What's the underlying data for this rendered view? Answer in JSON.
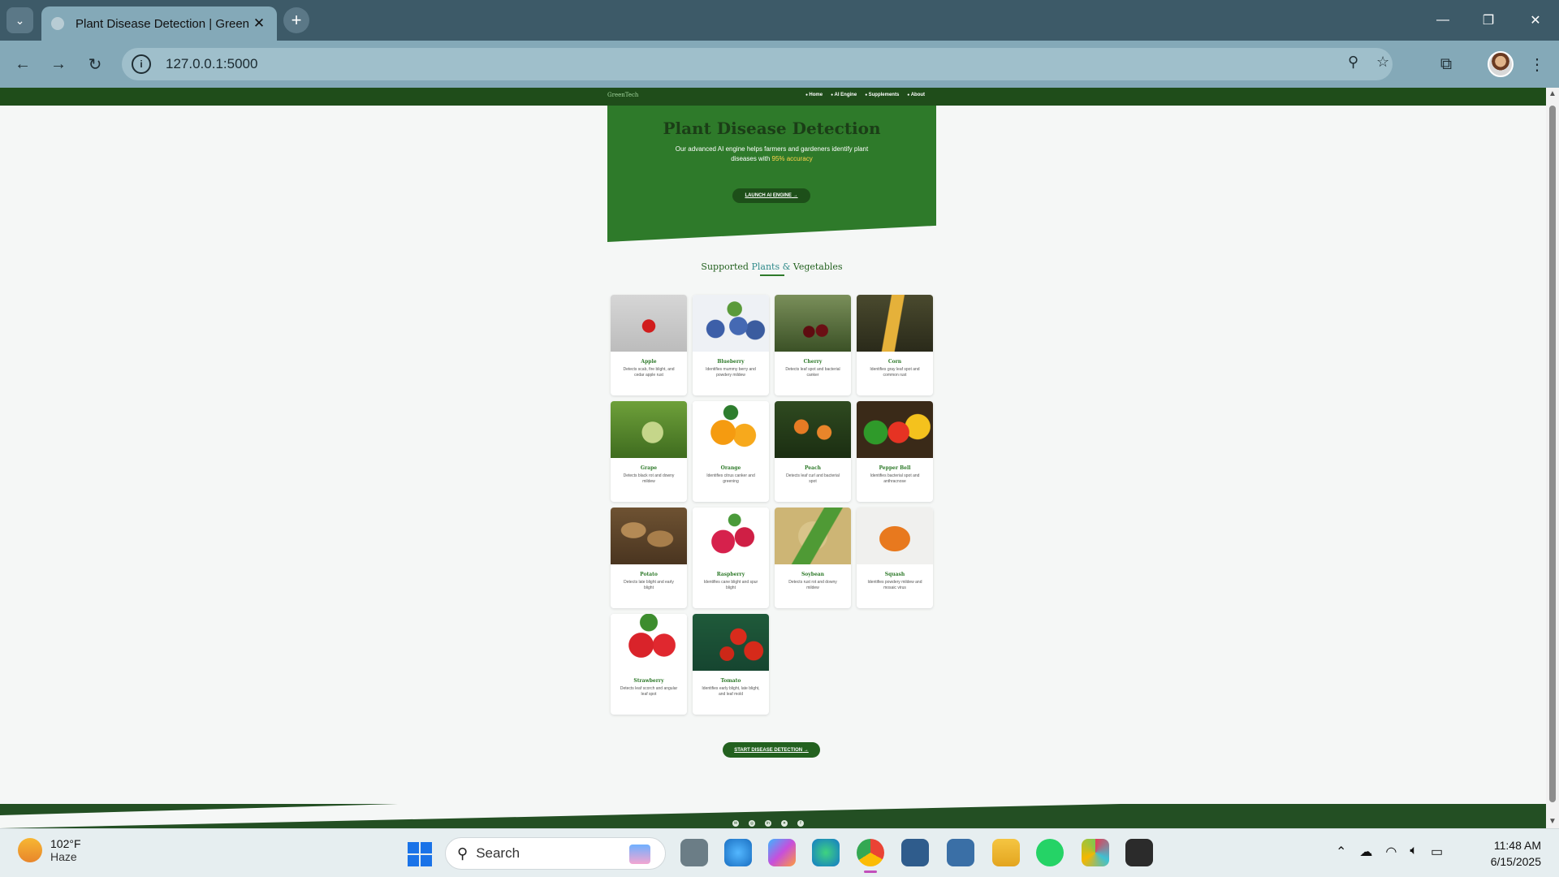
{
  "browser": {
    "tab_title": "Plant Disease Detection | Green",
    "url": "127.0.0.1:5000"
  },
  "site": {
    "logo": "GreenTech",
    "nav": [
      {
        "label": "Home",
        "icon": "home-icon",
        "active": true
      },
      {
        "label": "AI Engine",
        "icon": "robot-icon",
        "active": false
      },
      {
        "label": "Supplements",
        "icon": "store-icon",
        "active": false
      },
      {
        "label": "About",
        "icon": "user-icon",
        "active": false
      }
    ],
    "hero": {
      "title": "Plant Disease Detection",
      "subtitle_part1": "Our advanced AI engine helps farmers and gardeners identify plant diseases with ",
      "subtitle_accent": "95% accuracy",
      "button": "LAUNCH AI ENGINE"
    },
    "section_title_a": "Supported ",
    "section_title_b": "Plants & ",
    "section_title_c": "Vegetables",
    "plants": [
      {
        "name": "Apple",
        "desc": "Detects scab, fire blight, and cedar apple rust",
        "img": "apple"
      },
      {
        "name": "Blueberry",
        "desc": "Identifies mummy berry and powdery mildew",
        "img": "blueberry"
      },
      {
        "name": "Cherry",
        "desc": "Detects leaf spot and bacterial canker",
        "img": "cherry"
      },
      {
        "name": "Corn",
        "desc": "Identifies gray leaf spot and common rust",
        "img": "corn"
      },
      {
        "name": "Grape",
        "desc": "Detects black rot and downy mildew",
        "img": "grape"
      },
      {
        "name": "Orange",
        "desc": "Identifies citrus canker and greening",
        "img": "orange"
      },
      {
        "name": "Peach",
        "desc": "Detects leaf curl and bacterial spot",
        "img": "peach"
      },
      {
        "name": "Pepper Bell",
        "desc": "Identifies bacterial spot and anthracnose",
        "img": "pepper"
      },
      {
        "name": "Potato",
        "desc": "Detects late blight and early blight",
        "img": "potato"
      },
      {
        "name": "Raspberry",
        "desc": "Identifies cane blight and spur blight",
        "img": "raspberry"
      },
      {
        "name": "Soybean",
        "desc": "Detects rust rot and downy mildew",
        "img": "soybean"
      },
      {
        "name": "Squash",
        "desc": "Identifies powdery mildew and mosaic virus",
        "img": "squash"
      },
      {
        "name": "Strawberry",
        "desc": "Detects leaf scorch and angular leaf spot",
        "img": "strawberry"
      },
      {
        "name": "Tomato",
        "desc": "Identifies early blight, late blight, and leaf mold",
        "img": "tomato"
      }
    ],
    "cta": "START DISEASE DETECTION",
    "footer_icons": [
      "email-icon",
      "instagram-icon",
      "linkedin-icon",
      "twitter-icon",
      "facebook-icon"
    ]
  },
  "taskbar": {
    "weather_temp": "102°F",
    "weather_cond": "Haze",
    "search_label": "Search",
    "time": "11:48 AM",
    "date": "6/15/2025"
  },
  "colors": {
    "brand_green": "#2e7a2a",
    "dark_green": "#1f4d1a",
    "accent_yellow": "#ffd34d"
  }
}
